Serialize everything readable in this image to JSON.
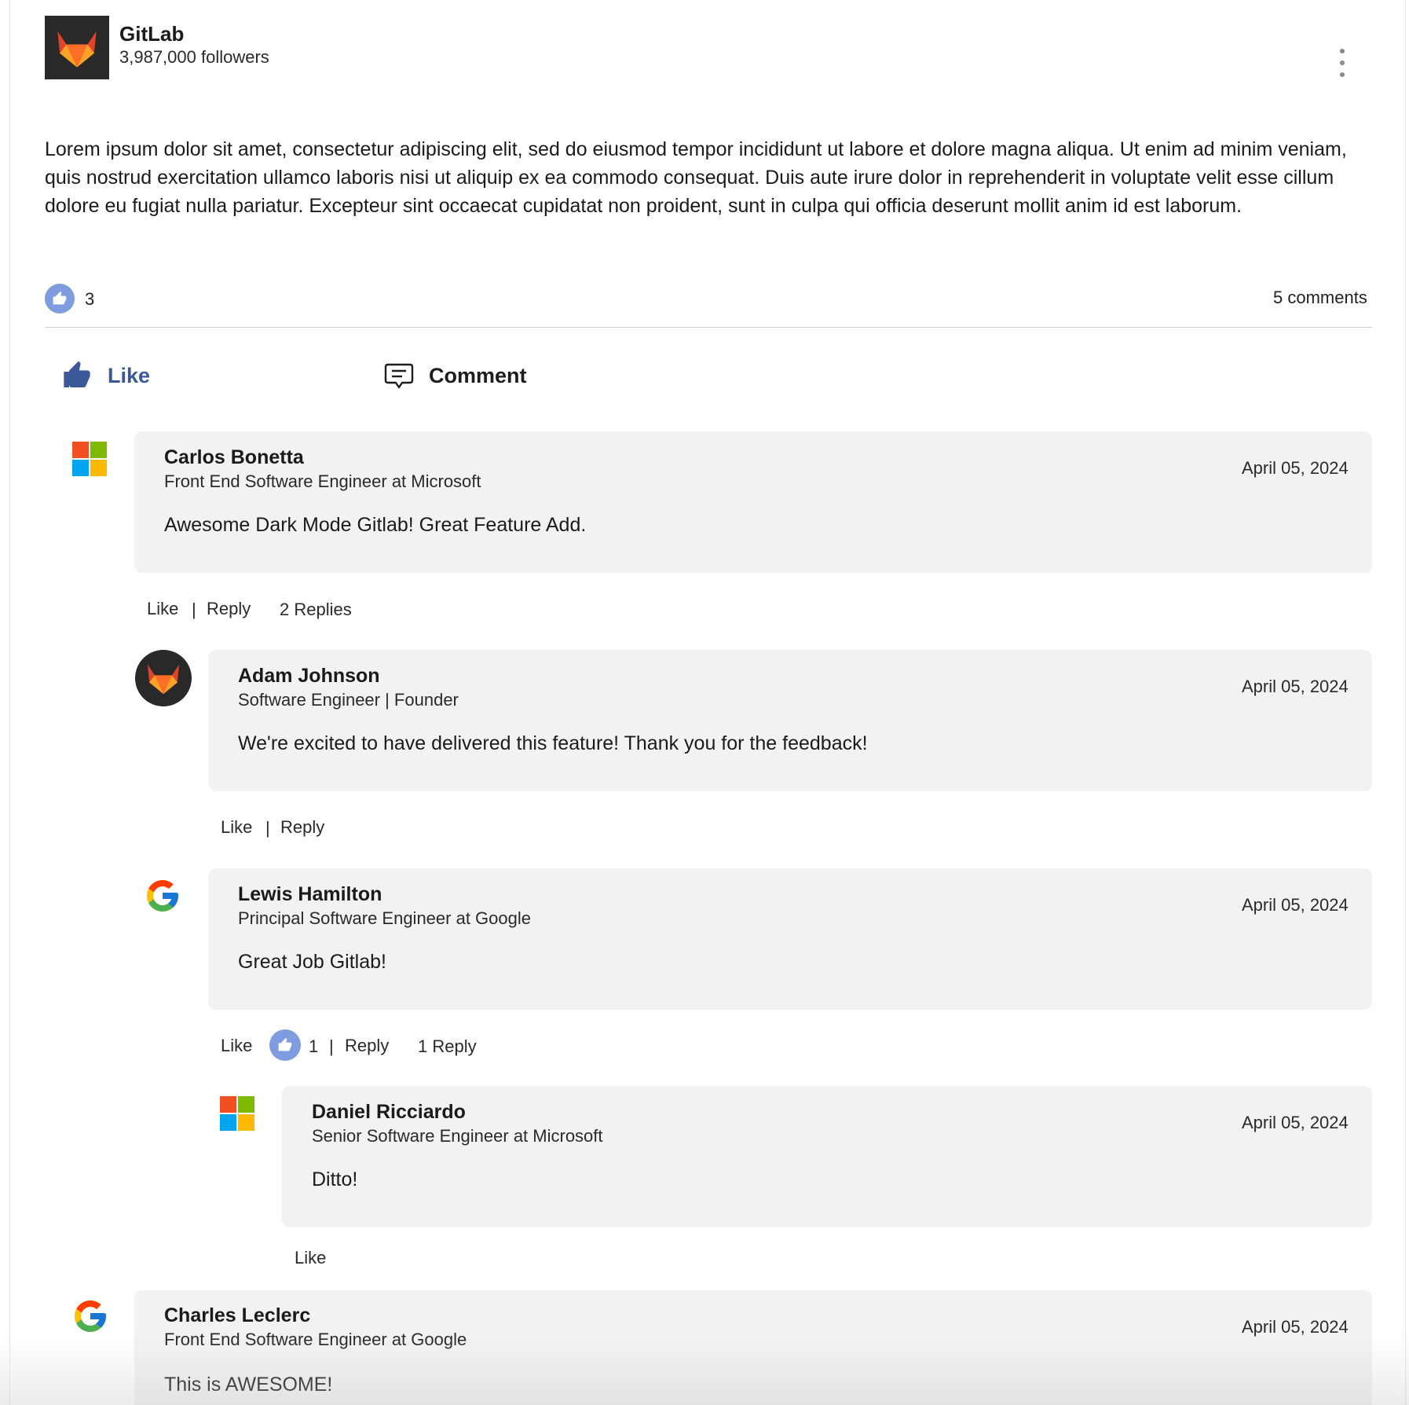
{
  "post": {
    "company": "GitLab",
    "followers": "3,987,000 followers",
    "body": "Lorem ipsum dolor sit amet, consectetur adipiscing elit, sed do eiusmod tempor incididunt ut labore et dolore magna aliqua. Ut enim ad minim veniam, quis nostrud exercitation ullamco laboris nisi ut aliquip ex ea commodo consequat. Duis aute irure dolor in reprehenderit in voluptate velit esse cillum dolore eu fugiat nulla pariatur. Excepteur sint occaecat cupidatat non proident, sunt in culpa qui officia deserunt mollit anim id est laborum.",
    "like_count": "3",
    "comments_count": "5 comments",
    "like_label": "Like",
    "comment_label": "Comment"
  },
  "colors": {
    "like_blue": "#3b5998",
    "badge_blue": "#7f9ce0",
    "bubble_bg": "#f2f2f2",
    "gitlab_orange": "#e24329"
  },
  "comments": [
    {
      "name": "Carlos Bonetta",
      "title": "Front End Software Engineer at Microsoft",
      "date": "April 05, 2024",
      "text": "Awesome Dark Mode Gitlab! Great Feature Add.",
      "avatar": "microsoft-logo",
      "like": "Like",
      "sep": "|",
      "reply": "Reply",
      "replies": "2 Replies"
    },
    {
      "name": "Adam Johnson",
      "title": "Software Engineer | Founder",
      "date": "April 05, 2024",
      "text": "We're excited to have delivered this feature! Thank you for the feedback!",
      "avatar": "gitlab-logo",
      "like": "Like",
      "sep": "|",
      "reply": "Reply"
    },
    {
      "name": "Lewis Hamilton",
      "title": "Principal Software Engineer at Google",
      "date": "April 05, 2024",
      "text": "Great Job Gitlab!",
      "avatar": "google-logo",
      "like": "Like",
      "like_count": "1",
      "sep": "|",
      "reply": "Reply",
      "replies": "1 Reply"
    },
    {
      "name": "Daniel Ricciardo",
      "title": "Senior Software Engineer at Microsoft",
      "date": "April 05, 2024",
      "text": "Ditto!",
      "avatar": "microsoft-logo",
      "like": "Like"
    },
    {
      "name": "Charles Leclerc",
      "title": "Front End Software Engineer at Google",
      "date": "April 05, 2024",
      "text": "This is AWESOME!",
      "avatar": "google-logo"
    }
  ]
}
